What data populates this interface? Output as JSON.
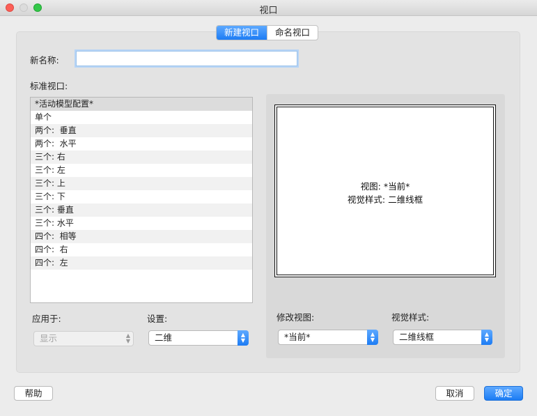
{
  "window": {
    "title": "视口"
  },
  "tabs": [
    {
      "label": "新建视口",
      "active": true
    },
    {
      "label": "命名视口",
      "active": false
    }
  ],
  "form": {
    "name_label": "新名称:",
    "name_value": "",
    "standard_label": "标准视口:"
  },
  "standard_viewports": [
    "*活动模型配置*",
    "单个",
    "两个:  垂直",
    "两个:  水平",
    "三个: 右",
    "三个: 左",
    "三个: 上",
    "三个: 下",
    "三个: 垂直",
    "三个: 水平",
    "四个:  相等",
    "四个:  右",
    "四个:  左"
  ],
  "preview": {
    "view_line": "视图: *当前*",
    "style_line": "视觉样式: 二维线框"
  },
  "apply_to": {
    "label": "应用于:",
    "value": "显示",
    "disabled": true
  },
  "setup": {
    "label": "设置:",
    "value": "二维"
  },
  "change_view": {
    "label": "修改视图:",
    "value": "*当前*"
  },
  "visual_style": {
    "label": "视觉样式:",
    "value": "二维线框"
  },
  "buttons": {
    "help": "帮助",
    "cancel": "取消",
    "ok": "确定"
  },
  "colors": {
    "accent": "#1c7cf4"
  }
}
